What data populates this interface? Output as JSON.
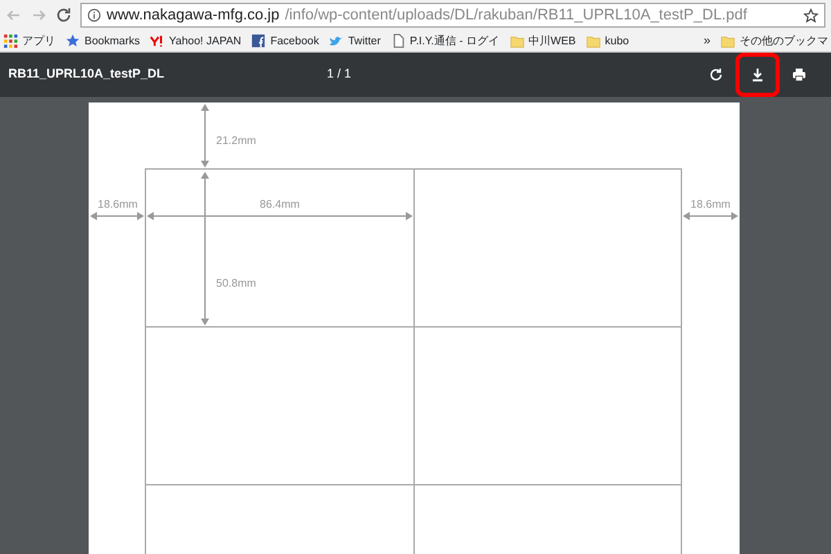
{
  "address_bar": {
    "host": "www.nakagawa-mfg.co.jp",
    "path": "/info/wp-content/uploads/DL/rakuban/RB11_UPRL10A_testP_DL.pdf"
  },
  "bookmarks": [
    {
      "kind": "apps",
      "label": "アプリ"
    },
    {
      "kind": "star",
      "label": "Bookmarks"
    },
    {
      "kind": "yahoo",
      "label": "Yahoo! JAPAN"
    },
    {
      "kind": "facebook",
      "label": "Facebook"
    },
    {
      "kind": "twitter",
      "label": "Twitter"
    },
    {
      "kind": "page",
      "label": "P.I.Y.通信 - ログイ"
    },
    {
      "kind": "folder",
      "label": "中川WEB"
    },
    {
      "kind": "folder",
      "label": "kubo"
    }
  ],
  "bookmarks_overflow": "»",
  "other_bookmarks": "その他のブックマ",
  "pdf_toolbar": {
    "title": "RB11_UPRL10A_testP_DL",
    "page_counter": "1 / 1",
    "buttons": [
      {
        "kind": "rotate",
        "highlighted": false
      },
      {
        "kind": "download",
        "highlighted": true
      },
      {
        "kind": "print",
        "highlighted": false
      }
    ]
  },
  "dimensions": {
    "top_margin": "21.2mm",
    "left_margin": "18.6mm",
    "label_width": "86.4mm",
    "label_height": "50.8mm",
    "right_margin": "18.6mm"
  }
}
